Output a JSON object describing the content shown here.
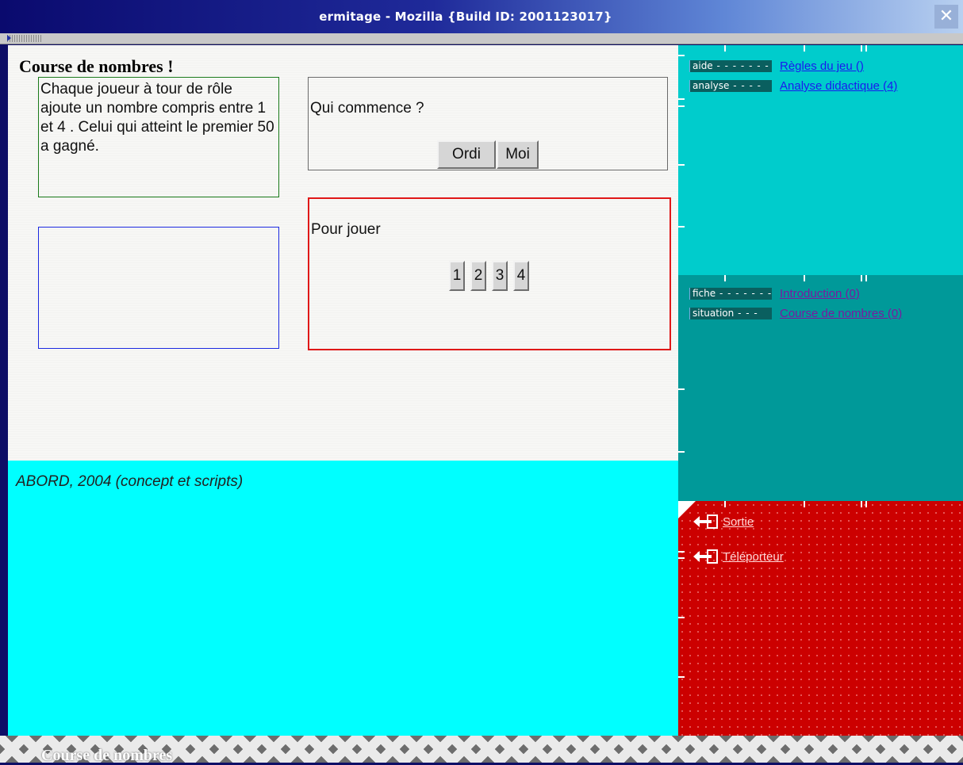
{
  "window": {
    "title": "ermitage - Mozilla {Build ID: 2001123017}",
    "close_symbol": "✕"
  },
  "main": {
    "page_title": "Course de nombres !",
    "rules_text": "Chaque joueur à tour de rôle ajoute un nombre compris entre 1 et 4 . Celui qui atteint le premier 50 a gagné.",
    "who_starts": {
      "label": "Qui commence ?",
      "buttons": [
        "Ordi",
        "Moi"
      ]
    },
    "play": {
      "label": "Pour jouer",
      "numbers": [
        "1",
        "2",
        "3",
        "4"
      ]
    },
    "credit": "ABORD, 2004 (concept et scripts)"
  },
  "right_panel": {
    "top": {
      "tabs": [
        {
          "tab": "aide",
          "link": "Règles du jeu ()"
        },
        {
          "tab": "analyse",
          "link": "Analyse didactique (4)"
        }
      ]
    },
    "middle": {
      "tabs": [
        {
          "tab": "fiche",
          "link": "Introduction (0)"
        },
        {
          "tab": "situation",
          "link": "Course de nombres (0)"
        }
      ]
    },
    "bottom": {
      "links": [
        "Sortie",
        "Téléporteur"
      ]
    }
  },
  "bottom_bar": {
    "title": "Course de nombres"
  },
  "colors": {
    "panel_top": "#00cccc",
    "panel_mid": "#009999",
    "panel_bottom": "#cc0000",
    "footer_cyan": "#00ffff"
  }
}
